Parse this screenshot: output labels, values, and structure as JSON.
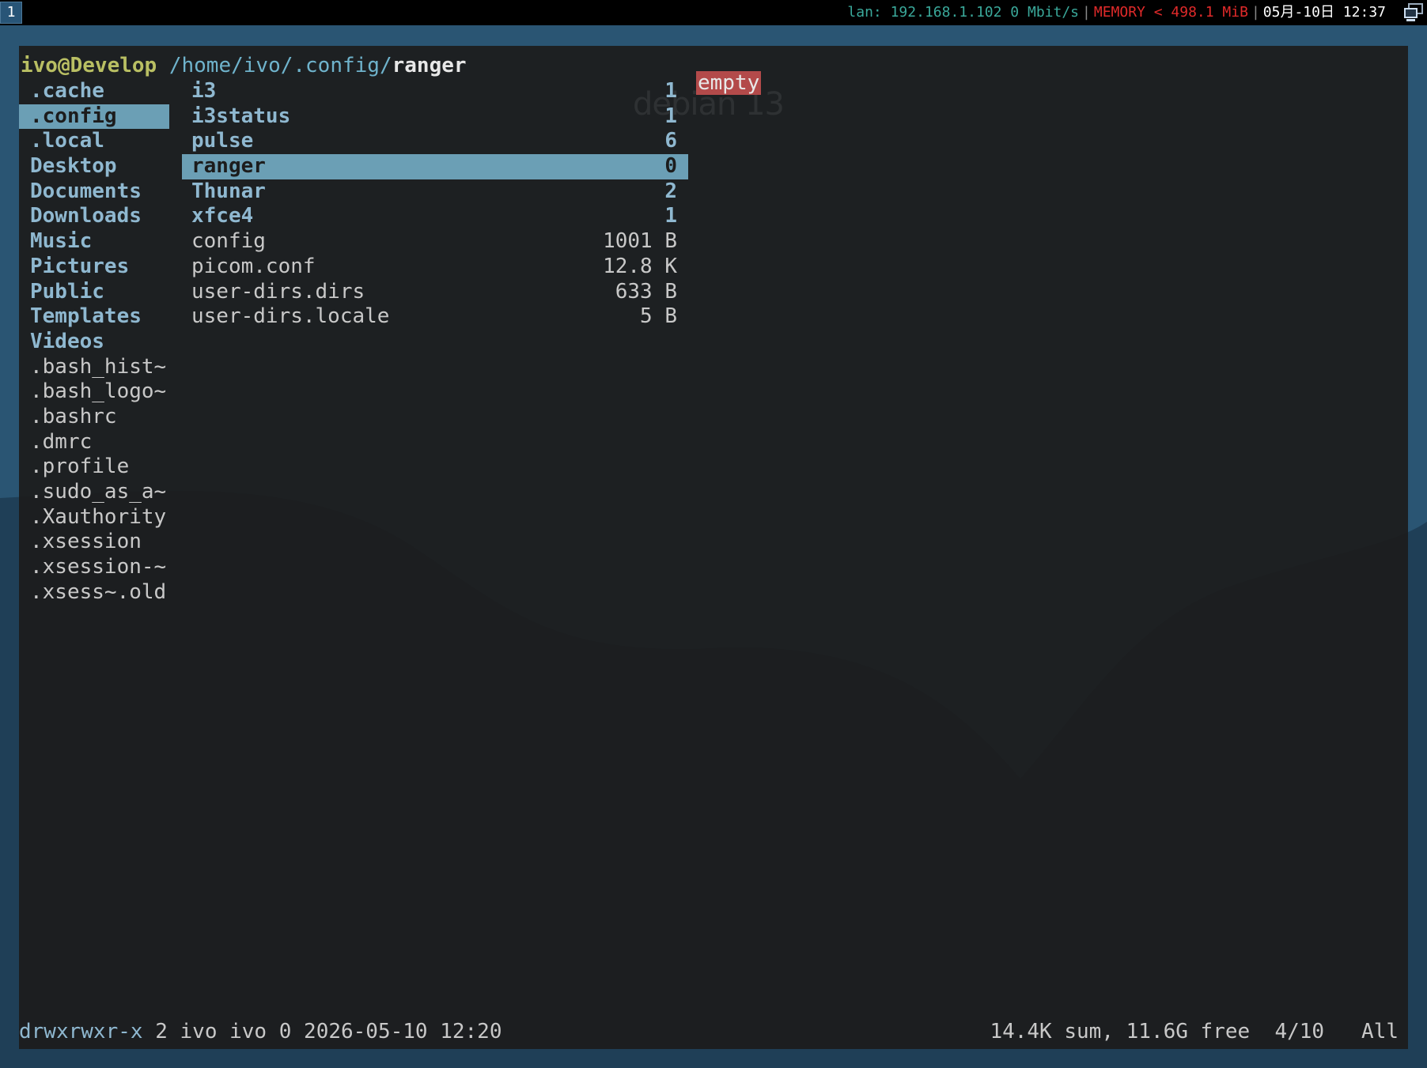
{
  "topbar": {
    "workspace": "1",
    "lan": "lan: 192.168.1.102 0 Mbit/s",
    "memory": "MEMORY < 498.1 MiB",
    "clock": "05月-10日 12:37",
    "tray_icon": "network-icon"
  },
  "terminal": {
    "title": {
      "user_host": "ivo@Develop",
      "path": "/home/ivo/.config/",
      "current": "ranger"
    },
    "parent_column": [
      {
        "name": ".cache",
        "type": "dir",
        "selected": false
      },
      {
        "name": ".config",
        "type": "dir",
        "selected": true
      },
      {
        "name": ".local",
        "type": "dir",
        "selected": false
      },
      {
        "name": "Desktop",
        "type": "dir",
        "selected": false
      },
      {
        "name": "Documents",
        "type": "dir",
        "selected": false
      },
      {
        "name": "Downloads",
        "type": "dir",
        "selected": false
      },
      {
        "name": "Music",
        "type": "dir",
        "selected": false
      },
      {
        "name": "Pictures",
        "type": "dir",
        "selected": false
      },
      {
        "name": "Public",
        "type": "dir",
        "selected": false
      },
      {
        "name": "Templates",
        "type": "dir",
        "selected": false
      },
      {
        "name": "Videos",
        "type": "dir",
        "selected": false
      },
      {
        "name": ".bash_hist~",
        "type": "file",
        "selected": false
      },
      {
        "name": ".bash_logo~",
        "type": "file",
        "selected": false
      },
      {
        "name": ".bashrc",
        "type": "file",
        "selected": false
      },
      {
        "name": ".dmrc",
        "type": "file",
        "selected": false
      },
      {
        "name": ".profile",
        "type": "file",
        "selected": false
      },
      {
        "name": ".sudo_as_a~",
        "type": "file",
        "selected": false
      },
      {
        "name": ".Xauthority",
        "type": "file",
        "selected": false
      },
      {
        "name": ".xsession",
        "type": "file",
        "selected": false
      },
      {
        "name": ".xsession-~",
        "type": "file",
        "selected": false
      },
      {
        "name": ".xsess~.old",
        "type": "file",
        "selected": false
      }
    ],
    "current_column": [
      {
        "name": "i3",
        "size": "1",
        "type": "dir",
        "selected": false
      },
      {
        "name": "i3status",
        "size": "1",
        "type": "dir",
        "selected": false
      },
      {
        "name": "pulse",
        "size": "6",
        "type": "dir",
        "selected": false
      },
      {
        "name": "ranger",
        "size": "0",
        "type": "dir",
        "selected": true
      },
      {
        "name": "Thunar",
        "size": "2",
        "type": "dir",
        "selected": false
      },
      {
        "name": "xfce4",
        "size": "1",
        "type": "dir",
        "selected": false
      },
      {
        "name": "config",
        "size": "1001 B",
        "type": "file",
        "selected": false
      },
      {
        "name": "picom.conf",
        "size": "12.8 K",
        "type": "file",
        "selected": false
      },
      {
        "name": "user-dirs.dirs",
        "size": "633 B",
        "type": "file",
        "selected": false
      },
      {
        "name": "user-dirs.locale",
        "size": "5 B",
        "type": "file",
        "selected": false
      }
    ],
    "preview": "empty",
    "wallpaper_logo": "debian 13",
    "status": {
      "perms": "drwxrwxr-x",
      "details": " 2 ivo ivo 0 2026-05-10 12:20",
      "summary": "14.4K sum, 11.6G free  4/10   All"
    }
  },
  "colors": {
    "selection": "#6b9fb5",
    "directory": "#8fb8d0",
    "preview_badge": "#b34a4a",
    "memory_warning": "#e02a2a",
    "lan": "#3aa89a"
  }
}
